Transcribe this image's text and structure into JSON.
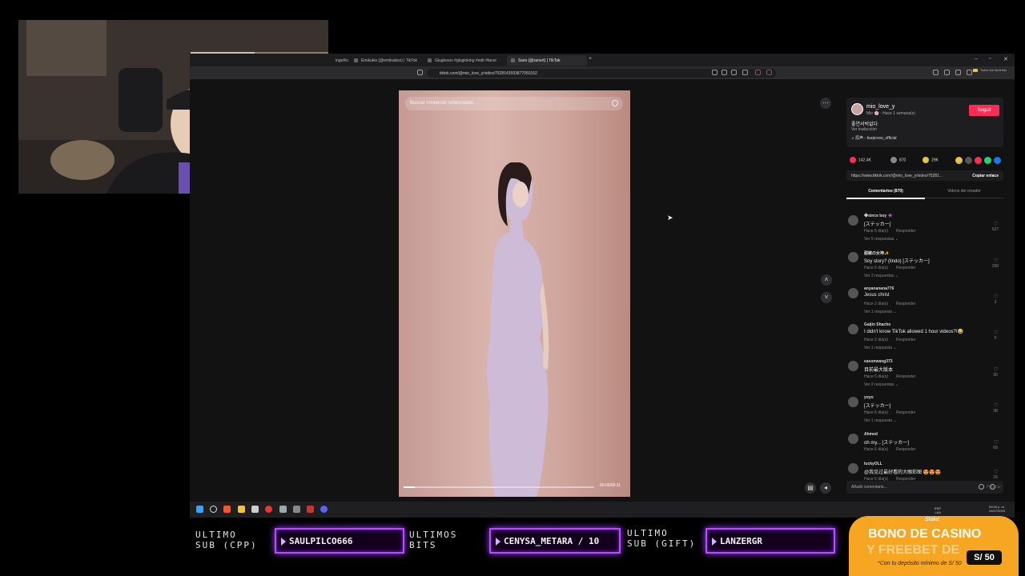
{
  "browser": {
    "tabs": [
      {
        "label": "ingeRobl"
      },
      {
        "label": "Emikukis (@emikukiss) | TikTok"
      },
      {
        "label": "Glugloooo #glugloking #edit #facet"
      },
      {
        "label": "Sses (@ssnvrt) | TikTok"
      }
    ],
    "url": "tiktok.com/@mio_love_y/video/7528143593877050152",
    "bookmarks_label": "Todos los favoritos"
  },
  "video": {
    "search_placeholder": "Buscar contenido relacionado",
    "time": "00:00/00:11",
    "progress": 0.06
  },
  "creator": {
    "username": "mio_love_y",
    "meta": "Mio 🌸 · Hace 1 semana(s)",
    "follow_label": "Seguir",
    "caption": "좋연서빅없다",
    "translate_label": "Ver traducción",
    "music": "♫  原声 - buqicrew_official"
  },
  "stats": {
    "likes": "142.4K",
    "comments": "870",
    "saves": "29K"
  },
  "share": {
    "link": "https://www.tiktok.com/@mio_love_y/video/75281...",
    "copy_label": "Copiar enlace"
  },
  "panel_tabs": {
    "comments": "Comentarios (870)",
    "creator_videos": "Videos del creador"
  },
  "comments": [
    {
      "name": "�since boy 👾",
      "text": "[ステッカー]",
      "meta": "Hace 6 día(s)",
      "reply": "Responder",
      "more": "Ver 5 respuestas ⌄",
      "likes": "527"
    },
    {
      "name": "甜椒の女神✨",
      "text": "Soy story? (lindo) [ステッカー]",
      "meta": "Hace 6 día(s)",
      "reply": "Responder",
      "more": "Ver 2 respuestas ⌄",
      "likes": "260"
    },
    {
      "name": "anyananana776",
      "text": "Jesus christ",
      "meta": "Hace 2 día(s)",
      "reply": "Responder",
      "more": "Ver 1 respuesta ⌄",
      "likes": "3"
    },
    {
      "name": "Gaijin Shacho",
      "text": "I didn't know TikTok allowed 1 hour videos?!😂",
      "meta": "Hace 2 día(s)",
      "reply": "Responder",
      "more": "Ver 1 respuesta ⌄",
      "likes": "0"
    },
    {
      "name": "easonwang373",
      "text": "目前最大版本",
      "meta": "Hace 5 día(s)",
      "reply": "Responder",
      "more": "Ver 2 respuestas ⌄",
      "likes": "30"
    },
    {
      "name": "yoyo",
      "text": "[ステッカー]",
      "meta": "Hace 6 día(s)",
      "reply": "Responder",
      "more": "Ver 1 respuesta ⌄",
      "likes": "38"
    },
    {
      "name": "Ahmed",
      "text": "oh my... [ステッカー]",
      "meta": "Hace 6 día(s)",
      "reply": "Responder",
      "more": "",
      "likes": "69"
    },
    {
      "name": "luckyOLL",
      "text": "@我见过最好看的大眼彩图 😍😍😍",
      "meta": "Hace 6 día(s)",
      "reply": "Responder",
      "more": "",
      "likes": "39"
    }
  ],
  "add_comment": {
    "placeholder": "Añadir comentario...",
    "publish": "Publicar"
  },
  "taskbar": {
    "tray_lang": "ESP\nLAA",
    "clock": "09:30 p. m.\n24/07/2025"
  },
  "overlay": {
    "last_sub_label": "ULTIMO\nSUB (CPP)",
    "last_sub_name": "SAULPILCO666",
    "last_bits_label": "ULTIMOS\nBITS",
    "last_bits_name": "CENYSA_METARA / 10",
    "last_gift_label": "ULTIMO\nSUB (GIFT)",
    "last_gift_name": "LANZERGR",
    "casino_brand": "Stake",
    "casino_title": "BONO DE CASINO",
    "casino_sub": "Y FREEBET DE",
    "casino_amount": "S/ 50",
    "casino_note": "*Con tu depósito mínimo de S/ 50"
  },
  "colors": {
    "accent_follow": "#fe2c55",
    "overlay_neon": "#b84cff",
    "casino_orange": "#f6a623"
  }
}
